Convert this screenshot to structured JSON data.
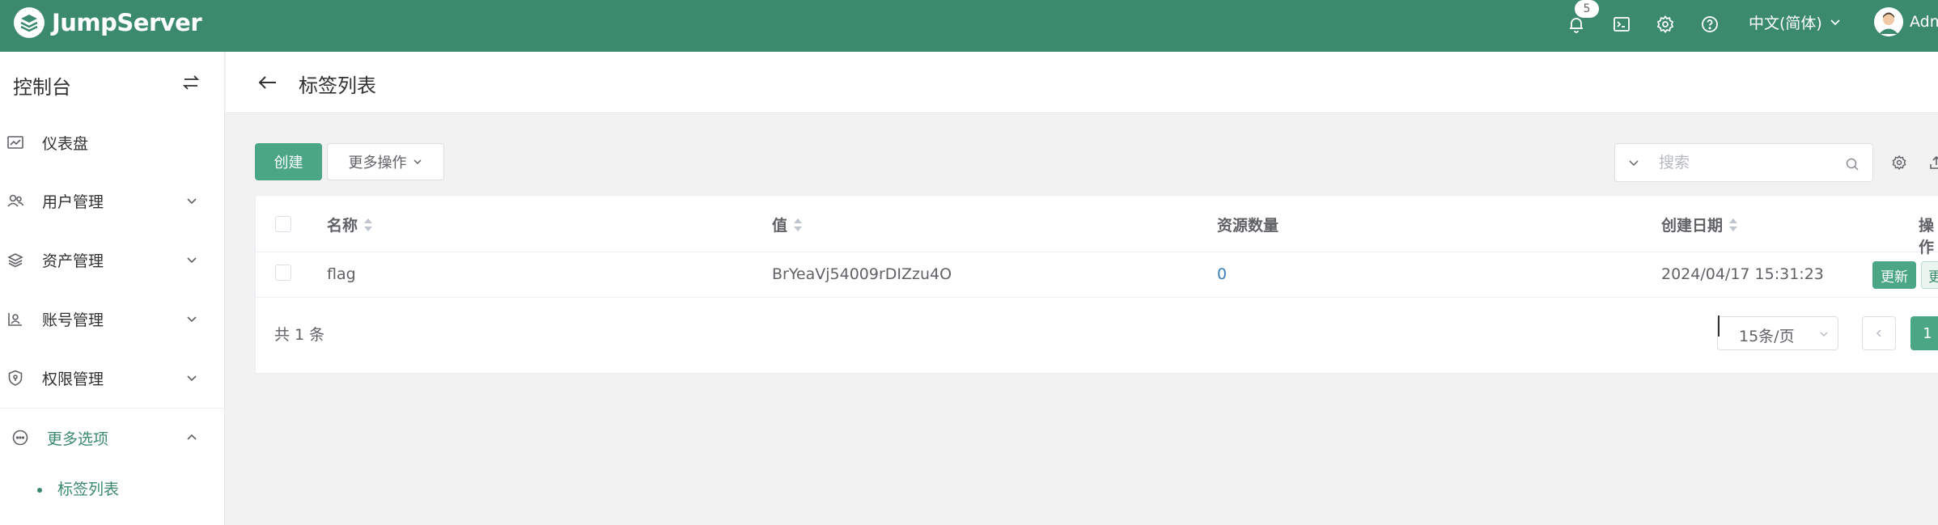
{
  "app": {
    "title": "JumpServer"
  },
  "colors": {
    "brand": "#3b8a6e",
    "primary_button": "#4aa685",
    "link": "#3b7fb8",
    "background": "#f2f2f2"
  },
  "header": {
    "notification_count": "5",
    "language": "中文(简体)",
    "user_name": "Adm",
    "icons": [
      "bell-icon",
      "terminal-icon",
      "gear-icon",
      "help-icon",
      "chevron-down-icon",
      "user-avatar-icon"
    ]
  },
  "sidebar": {
    "title": "控制台",
    "items": [
      {
        "label": "仪表盘",
        "icon": "dashboard-icon"
      },
      {
        "label": "用户管理",
        "icon": "users-icon"
      },
      {
        "label": "资产管理",
        "icon": "layers-icon"
      },
      {
        "label": "账号管理",
        "icon": "account-icon"
      },
      {
        "label": "权限管理",
        "icon": "shield-icon"
      },
      {
        "label": "更多选项",
        "icon": "more-circle-icon"
      }
    ],
    "sub_items": [
      {
        "label": "标签列表"
      }
    ]
  },
  "page": {
    "title": "标签列表"
  },
  "toolbar": {
    "create_label": "创建",
    "more_actions_label": "更多操作",
    "search_placeholder": "搜索"
  },
  "table": {
    "columns": [
      "名称",
      "值",
      "资源数量",
      "创建日期",
      "操作"
    ],
    "rows": [
      {
        "name": "flag",
        "value": "BrYeaVj54009rDIZzu4O",
        "resource_count": "0",
        "created": "2024/04/17 15:31:23",
        "action_update": "更新",
        "action_more": "更"
      }
    ]
  },
  "pagination": {
    "total_text": "共 1 条",
    "page_size": "15条/页",
    "current_page": "1"
  }
}
